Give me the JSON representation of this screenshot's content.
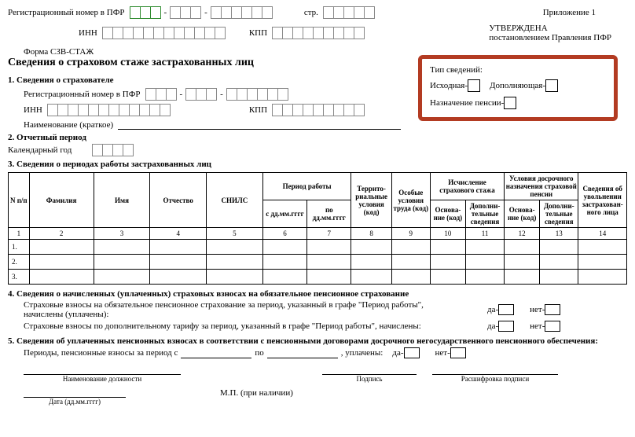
{
  "top": {
    "reg_label": "Регистрационный номер в ПФР",
    "page_label": "стр.",
    "appendix": "Приложение 1",
    "inn_label": "ИНН",
    "kpp_label": "КПП",
    "approved": "УТВЕРЖДЕНА",
    "approved_by": "постановлением Правления ПФР",
    "form_code": "Форма СЗВ-СТАЖ",
    "title": "Сведения о страховом стаже застрахованных лиц"
  },
  "highlight": {
    "title": "Тип сведений:",
    "opt1": "Исходная",
    "opt2": "Дополняющая",
    "opt3": "Назначение пенсии"
  },
  "s1": {
    "title": "1. Сведения о страхователе",
    "reg_label": "Регистрационный номер в ПФР",
    "inn_label": "ИНН",
    "kpp_label": "КПП",
    "name_label": "Наименование (краткое)"
  },
  "s2": {
    "title": "2. Отчетный период",
    "year_label": "Календарный год"
  },
  "s3": {
    "title": "3. Сведения о периодах работы застрахованных лиц"
  },
  "table": {
    "h_npp": "N п/п",
    "h_fam": "Фамилия",
    "h_name": "Имя",
    "h_otch": "Отчество",
    "h_snils": "СНИЛС",
    "h_period": "Период работы",
    "h_period_from": "с дд.мм.гггг",
    "h_period_to": "по дд.мм.гггг",
    "h_terr": "Террито-риальные условия (код)",
    "h_special": "Особые условия труда (код)",
    "h_calc": "Исчисление страхового стажа",
    "h_early": "Условия досрочного назначения страховой пенсии",
    "h_osn": "Основа-ние (код)",
    "h_dop": "Дополни-тельные сведения",
    "h_uvol": "Сведения об увольнении застрахован-ного лица",
    "cols": [
      "1",
      "2",
      "3",
      "4",
      "5",
      "6",
      "7",
      "8",
      "9",
      "10",
      "11",
      "12",
      "13",
      "14"
    ],
    "rows": [
      "1.",
      "2.",
      "3."
    ]
  },
  "s4": {
    "title": "4. Сведения о начисленных (уплаченных) страховых взносах на обязательное пенсионное страхование",
    "line1": "Страховые взносы на обязательное пенсионное страхование за период, указанный в графе \"Период работы\", начислены (уплачены):",
    "line2": "Страховые взносы по дополнительному тарифу за период, указанный в графе \"Период работы\", начислены:",
    "yes": "да-",
    "no": "нет-"
  },
  "s5": {
    "title": "5. Сведения об уплаченных пенсионных взносах в соответствии с пенсионными договорами досрочного негосударственного пенсионного обеспечения:",
    "period": "Периоды, пенсионные взносы за период с",
    "po": "по",
    "paid": ", уплачены:",
    "yes": "да-",
    "no": "нет-"
  },
  "footer": {
    "position": "Наименование должности",
    "sign": "Подпись",
    "decode": "Расшифровка подписи",
    "date": "Дата (дд.мм.гггг)",
    "mp": "М.П. (при наличии)"
  }
}
